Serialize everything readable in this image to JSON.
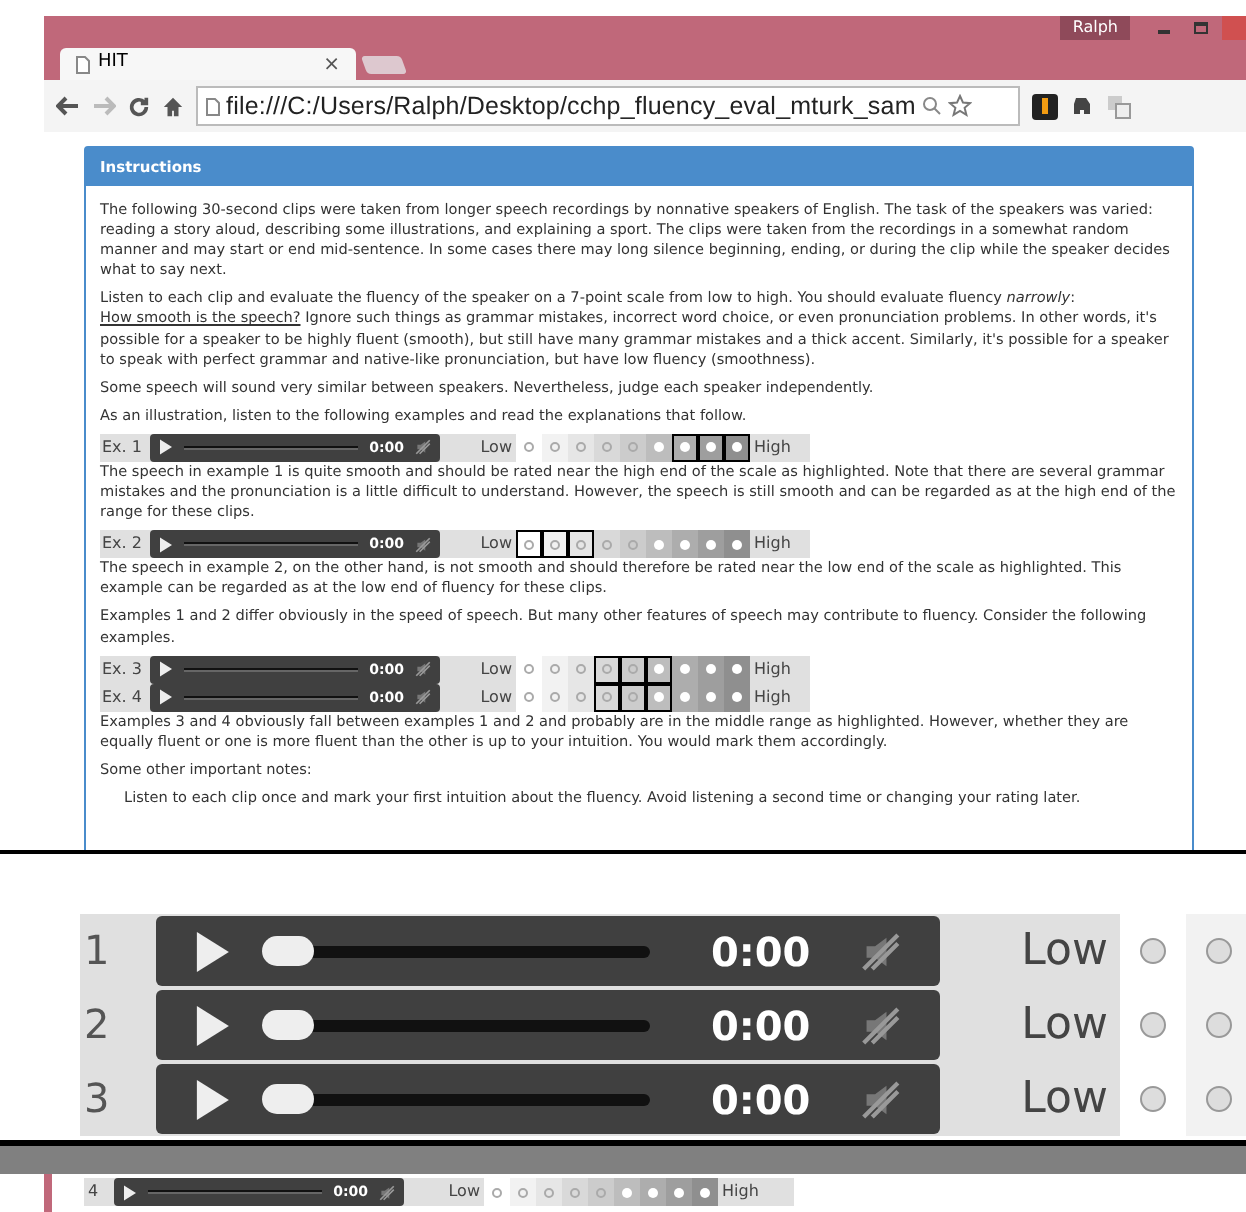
{
  "window": {
    "user": "Ralph"
  },
  "tab": {
    "title": "HIT",
    "close": "×"
  },
  "address_bar": {
    "url": "file:///C:/Users/Ralph/Desktop/cchp_fluency_eval_mturk_sam"
  },
  "instructions": {
    "title": "Instructions",
    "p1": "The following 30-second clips were taken from longer speech recordings by nonnative speakers of English. The task of the speakers was varied: reading a story aloud, describing some illustrations, and explaining a sport. The clips were taken from the recordings in a somewhat random manner and may start or end mid-sentence. In some cases there may long silence beginning, ending, or during the clip while the speaker decides what to say next.",
    "p2_before": "Listen to each clip and evaluate the fluency of the speaker on a 7-point scale from low to high. You should evaluate fluency *narrowly*: ",
    "p2_link": "How smooth is the speech?",
    "p2_after": " Ignore such things as grammar mistakes, incorrect word choice, or even pronunciation problems. In other words, it's possible for a speaker to be highly fluent (smooth), but still have many grammar mistakes and a thick accent. Similarly, it's possible for a speaker to speak with perfect grammar and native-like pronunciation, but have low fluency (smoothness).",
    "p3": "Some speech will sound very similar between speakers. Nevertheless, judge each speaker independently.",
    "p4": "As an illustration, listen to the following examples and read the explanations that follow.",
    "ex1": {
      "label": "Ex. 1",
      "time": "0:00",
      "low": "Low",
      "high": "High",
      "highlight": [
        false,
        false,
        false,
        false,
        false,
        false,
        true,
        true,
        true
      ]
    },
    "p5": "The speech in example 1 is quite smooth and should be rated near the high end of the scale as highlighted. Note that there are several grammar mistakes and the pronunciation is a little difficult to understand. However, the speech is still smooth and can be regarded as at the high end of the range for these clips.",
    "ex2": {
      "label": "Ex. 2",
      "time": "0:00",
      "low": "Low",
      "high": "High",
      "highlight": [
        true,
        true,
        true,
        false,
        false,
        false,
        false,
        false,
        false
      ]
    },
    "p6": "The speech in example 2, on the other hand, is not smooth and should therefore be rated near the low end of the scale as highlighted. This example can be regarded as at the low end of fluency for these clips.",
    "p7": "Examples 1 and 2 differ obviously in the speed of speech. But many other features of speech may contribute to fluency. Consider the following examples.",
    "ex34": [
      {
        "label": "Ex. 3",
        "time": "0:00",
        "low": "Low",
        "high": "High",
        "highlight": [
          false,
          false,
          false,
          true,
          true,
          true,
          false,
          false,
          false
        ]
      },
      {
        "label": "Ex. 4",
        "time": "0:00",
        "low": "Low",
        "high": "High",
        "highlight": [
          false,
          false,
          false,
          true,
          true,
          true,
          false,
          false,
          false
        ]
      }
    ],
    "p8": "Examples 3 and 4 obviously fall between examples 1 and 2 and probably are in the middle range as highlighted. However, whether they are equally fluent or one is more fluent than the other is up to your intuition. You would mark them accordingly.",
    "p9": "Some other important notes:",
    "note": "Listen to each clip once and mark your first intuition about the fluency. Avoid listening a second time or changing your rating later."
  },
  "zoomed_rows": [
    {
      "number": "1",
      "time": "0:00",
      "low": "Low",
      "level": 0
    },
    {
      "number": "2",
      "time": "0:00",
      "low": "Low",
      "level": 0
    },
    {
      "number": "3",
      "time": "0:00",
      "low": "Low",
      "level": 0
    }
  ],
  "rating_rows": [
    {
      "number": "4",
      "time": "0:00",
      "low": "Low",
      "high": "High",
      "highlight": [
        false,
        false,
        false,
        false,
        false,
        false,
        false,
        false,
        false
      ]
    }
  ]
}
